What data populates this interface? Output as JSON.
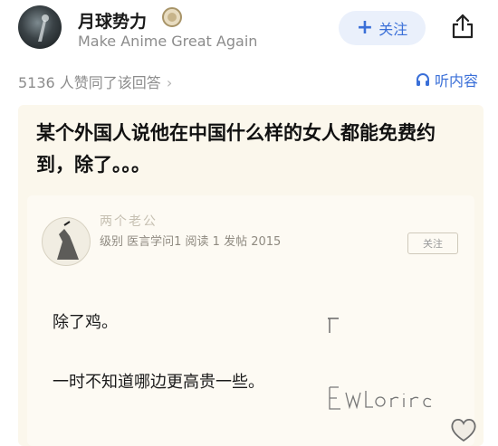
{
  "header": {
    "author_name": "月球势力",
    "author_motto": "Make Anime Great Again",
    "follow_label": "关注",
    "follow_plus": "+"
  },
  "stats": {
    "likes_text": "5136 人赞同了该回答",
    "chevron": "›",
    "listen_label": "听内容"
  },
  "post": {
    "question": "某个外国人说他在中国什么样的女人都能免费约到，除了。。。",
    "forum_username": "两个老公",
    "forum_meta": "级别 医言学问1 阅读 1 发帖 2015",
    "forum_button": "关注",
    "reply_line1": "除了鸡。",
    "reply_line2": "一时不知道哪边更高贵一些。"
  },
  "icons": {
    "badge": "medal-badge-icon",
    "share": "share-icon",
    "listen": "headphones-icon",
    "heart": "heart-icon"
  },
  "colors": {
    "accent": "#3a6fd8",
    "follow_bg": "#eaf0fb",
    "card_bg": "#fbf7ec",
    "muted": "#8c8c8c"
  }
}
